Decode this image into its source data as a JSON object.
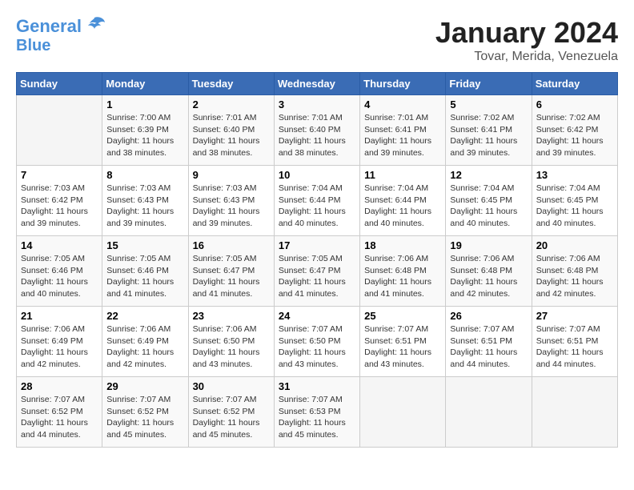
{
  "logo": {
    "line1": "General",
    "line2": "Blue"
  },
  "title": "January 2024",
  "subtitle": "Tovar, Merida, Venezuela",
  "headers": [
    "Sunday",
    "Monday",
    "Tuesday",
    "Wednesday",
    "Thursday",
    "Friday",
    "Saturday"
  ],
  "weeks": [
    [
      {
        "day": "",
        "info": ""
      },
      {
        "day": "1",
        "info": "Sunrise: 7:00 AM\nSunset: 6:39 PM\nDaylight: 11 hours\nand 38 minutes."
      },
      {
        "day": "2",
        "info": "Sunrise: 7:01 AM\nSunset: 6:40 PM\nDaylight: 11 hours\nand 38 minutes."
      },
      {
        "day": "3",
        "info": "Sunrise: 7:01 AM\nSunset: 6:40 PM\nDaylight: 11 hours\nand 38 minutes."
      },
      {
        "day": "4",
        "info": "Sunrise: 7:01 AM\nSunset: 6:41 PM\nDaylight: 11 hours\nand 39 minutes."
      },
      {
        "day": "5",
        "info": "Sunrise: 7:02 AM\nSunset: 6:41 PM\nDaylight: 11 hours\nand 39 minutes."
      },
      {
        "day": "6",
        "info": "Sunrise: 7:02 AM\nSunset: 6:42 PM\nDaylight: 11 hours\nand 39 minutes."
      }
    ],
    [
      {
        "day": "7",
        "info": "Sunrise: 7:03 AM\nSunset: 6:42 PM\nDaylight: 11 hours\nand 39 minutes."
      },
      {
        "day": "8",
        "info": "Sunrise: 7:03 AM\nSunset: 6:43 PM\nDaylight: 11 hours\nand 39 minutes."
      },
      {
        "day": "9",
        "info": "Sunrise: 7:03 AM\nSunset: 6:43 PM\nDaylight: 11 hours\nand 39 minutes."
      },
      {
        "day": "10",
        "info": "Sunrise: 7:04 AM\nSunset: 6:44 PM\nDaylight: 11 hours\nand 40 minutes."
      },
      {
        "day": "11",
        "info": "Sunrise: 7:04 AM\nSunset: 6:44 PM\nDaylight: 11 hours\nand 40 minutes."
      },
      {
        "day": "12",
        "info": "Sunrise: 7:04 AM\nSunset: 6:45 PM\nDaylight: 11 hours\nand 40 minutes."
      },
      {
        "day": "13",
        "info": "Sunrise: 7:04 AM\nSunset: 6:45 PM\nDaylight: 11 hours\nand 40 minutes."
      }
    ],
    [
      {
        "day": "14",
        "info": "Sunrise: 7:05 AM\nSunset: 6:46 PM\nDaylight: 11 hours\nand 40 minutes."
      },
      {
        "day": "15",
        "info": "Sunrise: 7:05 AM\nSunset: 6:46 PM\nDaylight: 11 hours\nand 41 minutes."
      },
      {
        "day": "16",
        "info": "Sunrise: 7:05 AM\nSunset: 6:47 PM\nDaylight: 11 hours\nand 41 minutes."
      },
      {
        "day": "17",
        "info": "Sunrise: 7:05 AM\nSunset: 6:47 PM\nDaylight: 11 hours\nand 41 minutes."
      },
      {
        "day": "18",
        "info": "Sunrise: 7:06 AM\nSunset: 6:48 PM\nDaylight: 11 hours\nand 41 minutes."
      },
      {
        "day": "19",
        "info": "Sunrise: 7:06 AM\nSunset: 6:48 PM\nDaylight: 11 hours\nand 42 minutes."
      },
      {
        "day": "20",
        "info": "Sunrise: 7:06 AM\nSunset: 6:48 PM\nDaylight: 11 hours\nand 42 minutes."
      }
    ],
    [
      {
        "day": "21",
        "info": "Sunrise: 7:06 AM\nSunset: 6:49 PM\nDaylight: 11 hours\nand 42 minutes."
      },
      {
        "day": "22",
        "info": "Sunrise: 7:06 AM\nSunset: 6:49 PM\nDaylight: 11 hours\nand 42 minutes."
      },
      {
        "day": "23",
        "info": "Sunrise: 7:06 AM\nSunset: 6:50 PM\nDaylight: 11 hours\nand 43 minutes."
      },
      {
        "day": "24",
        "info": "Sunrise: 7:07 AM\nSunset: 6:50 PM\nDaylight: 11 hours\nand 43 minutes."
      },
      {
        "day": "25",
        "info": "Sunrise: 7:07 AM\nSunset: 6:51 PM\nDaylight: 11 hours\nand 43 minutes."
      },
      {
        "day": "26",
        "info": "Sunrise: 7:07 AM\nSunset: 6:51 PM\nDaylight: 11 hours\nand 44 minutes."
      },
      {
        "day": "27",
        "info": "Sunrise: 7:07 AM\nSunset: 6:51 PM\nDaylight: 11 hours\nand 44 minutes."
      }
    ],
    [
      {
        "day": "28",
        "info": "Sunrise: 7:07 AM\nSunset: 6:52 PM\nDaylight: 11 hours\nand 44 minutes."
      },
      {
        "day": "29",
        "info": "Sunrise: 7:07 AM\nSunset: 6:52 PM\nDaylight: 11 hours\nand 45 minutes."
      },
      {
        "day": "30",
        "info": "Sunrise: 7:07 AM\nSunset: 6:52 PM\nDaylight: 11 hours\nand 45 minutes."
      },
      {
        "day": "31",
        "info": "Sunrise: 7:07 AM\nSunset: 6:53 PM\nDaylight: 11 hours\nand 45 minutes."
      },
      {
        "day": "",
        "info": ""
      },
      {
        "day": "",
        "info": ""
      },
      {
        "day": "",
        "info": ""
      }
    ]
  ]
}
